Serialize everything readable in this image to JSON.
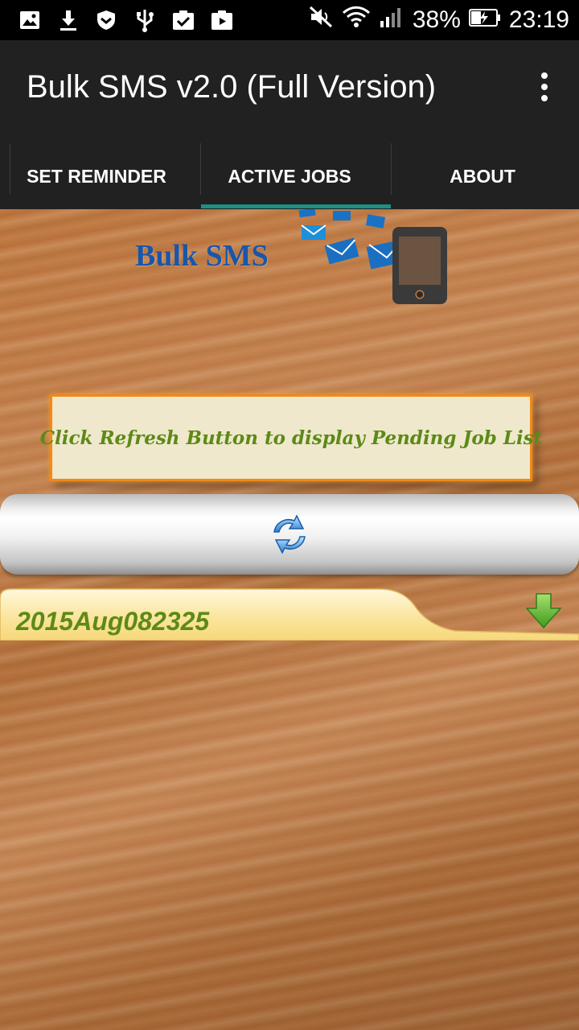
{
  "status_bar": {
    "battery_percent": "38%",
    "time": "23:19",
    "icons": [
      "image-icon",
      "download-icon",
      "shield-icon",
      "usb-icon",
      "clipboard-check-icon",
      "play-store-icon",
      "mute-icon",
      "wifi-icon",
      "signal-icon",
      "battery-charging-icon"
    ]
  },
  "app_bar": {
    "title": "Bulk SMS v2.0 (Full Version)",
    "menu_icon": "overflow-menu-icon"
  },
  "tabs": [
    {
      "label": "SET REMINDER",
      "selected": false
    },
    {
      "label": "ACTIVE JOBS",
      "selected": true
    },
    {
      "label": "ABOUT",
      "selected": false
    }
  ],
  "logo": {
    "text": "Bulk SMS"
  },
  "info_box": {
    "text": "Click Refresh Button to display Pending Job List"
  },
  "refresh_button": {
    "icon": "refresh-icon"
  },
  "jobs": [
    {
      "label": "2015Aug082325",
      "icon": "down-arrow-icon"
    }
  ],
  "colors": {
    "app_bar": "#212121",
    "tab_indicator": "#1f8f7f",
    "info_border": "#f08a18",
    "info_text": "#5d8a16",
    "logo_text": "#1a56a8",
    "job_text": "#5d8a16"
  }
}
